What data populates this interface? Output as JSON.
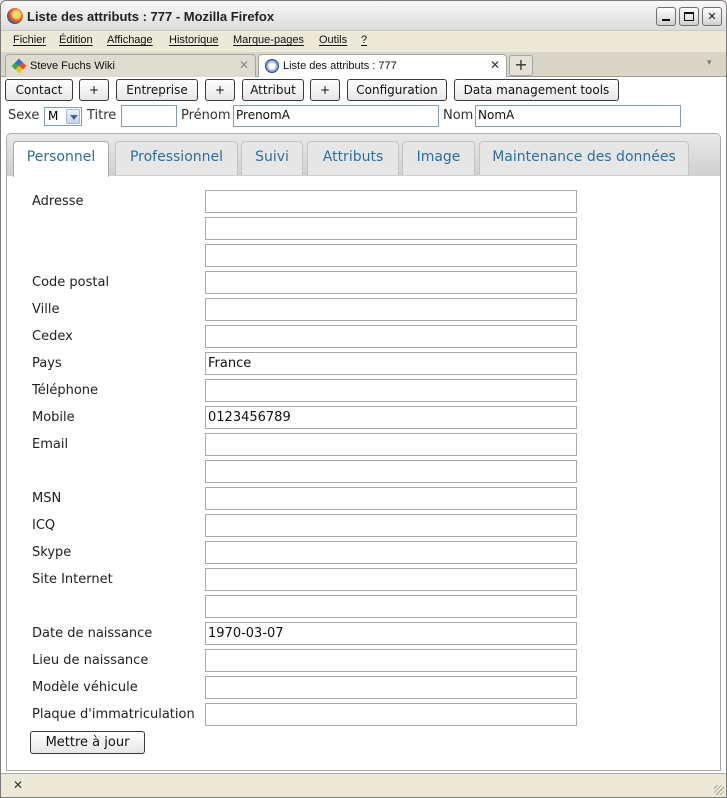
{
  "window": {
    "title": "Liste des attributs : 777 - Mozilla Firefox",
    "minimize_glyph": "",
    "maximize_glyph": "",
    "close_glyph": "✕"
  },
  "menu": [
    "Fichier",
    "Édition",
    "Affichage",
    "Historique",
    "Marque-pages",
    "Outils",
    "?"
  ],
  "browser_tabs": [
    {
      "label": "Steve Fuchs Wiki",
      "close": "✕",
      "active": false,
      "icon": "wiki-favicon-icon"
    },
    {
      "label": "Liste des attributs : 777",
      "close": "✕",
      "active": true,
      "icon": "page-favicon-icon"
    }
  ],
  "new_tab_glyph": "+",
  "tab_list_glyph": "▾",
  "toolbar_buttons": [
    "Contact",
    "+",
    "Entreprise",
    "+",
    "Attribut",
    "+",
    "Configuration",
    "Data management tools"
  ],
  "identity": {
    "sexe_label": "Sexe",
    "sexe_value": "M",
    "titre_label": "Titre",
    "titre_value": "",
    "prenom_label": "Prénom",
    "prenom_value": "PrenomA",
    "nom_label": "Nom",
    "nom_value": "NomA"
  },
  "panel_tabs": [
    "Personnel",
    "Professionnel",
    "Suivi",
    "Attributs",
    "Image",
    "Maintenance des données"
  ],
  "active_panel_tab": "Personnel",
  "form": {
    "labels": {
      "adresse": "Adresse",
      "code_postal": "Code postal",
      "ville": "Ville",
      "cedex": "Cedex",
      "pays": "Pays",
      "telephone": "Téléphone",
      "mobile": "Mobile",
      "email": "Email",
      "msn": "MSN",
      "icq": "ICQ",
      "skype": "Skype",
      "site_internet": "Site Internet",
      "date_naissance": "Date de naissance",
      "lieu_naissance": "Lieu de naissance",
      "modele_vehicule": "Modèle véhicule",
      "plaque": "Plaque d'immatriculation"
    },
    "values": {
      "adresse_1": "",
      "adresse_2": "",
      "adresse_3": "",
      "code_postal": "",
      "ville": "",
      "cedex": "",
      "pays": "France",
      "telephone": "",
      "mobile": "0123456789",
      "email_1": "",
      "email_2": "",
      "msn": "",
      "icq": "",
      "skype": "",
      "site_internet_1": "",
      "site_internet_2": "",
      "date_naissance": "1970-03-07",
      "lieu_naissance": "",
      "modele_vehicule": "",
      "plaque": ""
    },
    "submit_label": "Mettre à jour"
  },
  "statusbar": {
    "close_glyph": "✕"
  }
}
